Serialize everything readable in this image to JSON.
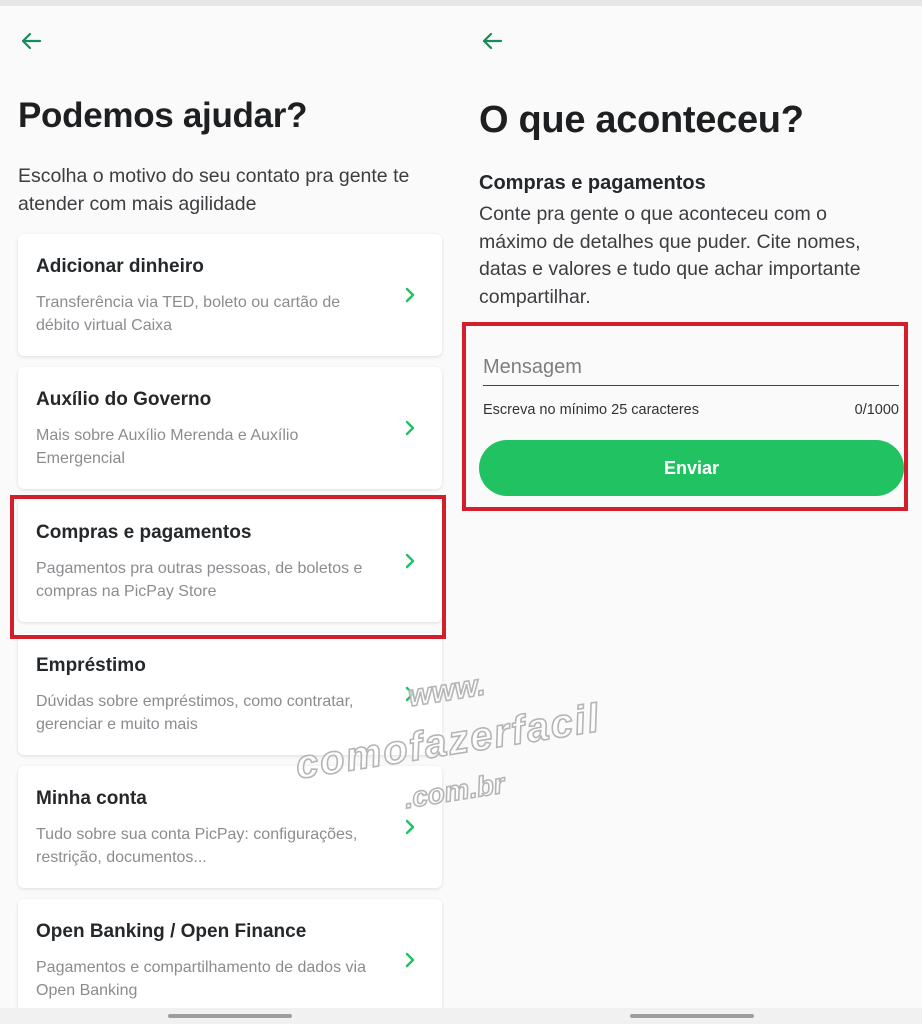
{
  "colors": {
    "accent": "#20c262",
    "back_arrow": "#178b5a",
    "highlight": "#d21f2b"
  },
  "left_screen": {
    "back_icon": "arrow-left-icon",
    "title": "Podemos ajudar?",
    "subtitle": "Escolha o motivo do seu contato pra gente te atender com mais agilidade",
    "topics": [
      {
        "title": "Adicionar dinheiro",
        "description": "Transferência via TED, boleto ou cartão de débito virtual Caixa"
      },
      {
        "title": "Auxílio do Governo",
        "description": "Mais sobre Auxílio Merenda e Auxílio Emergencial"
      },
      {
        "title": "Compras e pagamentos",
        "description": "Pagamentos pra outras pessoas, de boletos e compras na PicPay Store"
      },
      {
        "title": "Empréstimo",
        "description": "Dúvidas sobre empréstimos, como contratar, gerenciar e muito mais"
      },
      {
        "title": "Minha conta",
        "description": "Tudo sobre sua conta PicPay: configurações, restrição, documentos..."
      },
      {
        "title": "Open Banking / Open Finance",
        "description": "Pagamentos e compartilhamento de dados via Open Banking"
      }
    ]
  },
  "right_screen": {
    "back_icon": "arrow-left-icon",
    "title": "O que aconteceu?",
    "section_title": "Compras e pagamentos",
    "section_description": "Conte pra gente o que aconteceu com o máximo de detalhes que puder. Cite nomes, datas e valores e tudo que achar importante compartilhar.",
    "message_field": {
      "placeholder": "Mensagem",
      "value": ""
    },
    "hint": "Escreva no mínimo 25 caracteres",
    "counter": "0/1000",
    "submit_label": "Enviar"
  },
  "watermark": {
    "line1": "www.",
    "line2": "comofazerfacil",
    "line3": ".com.br"
  }
}
